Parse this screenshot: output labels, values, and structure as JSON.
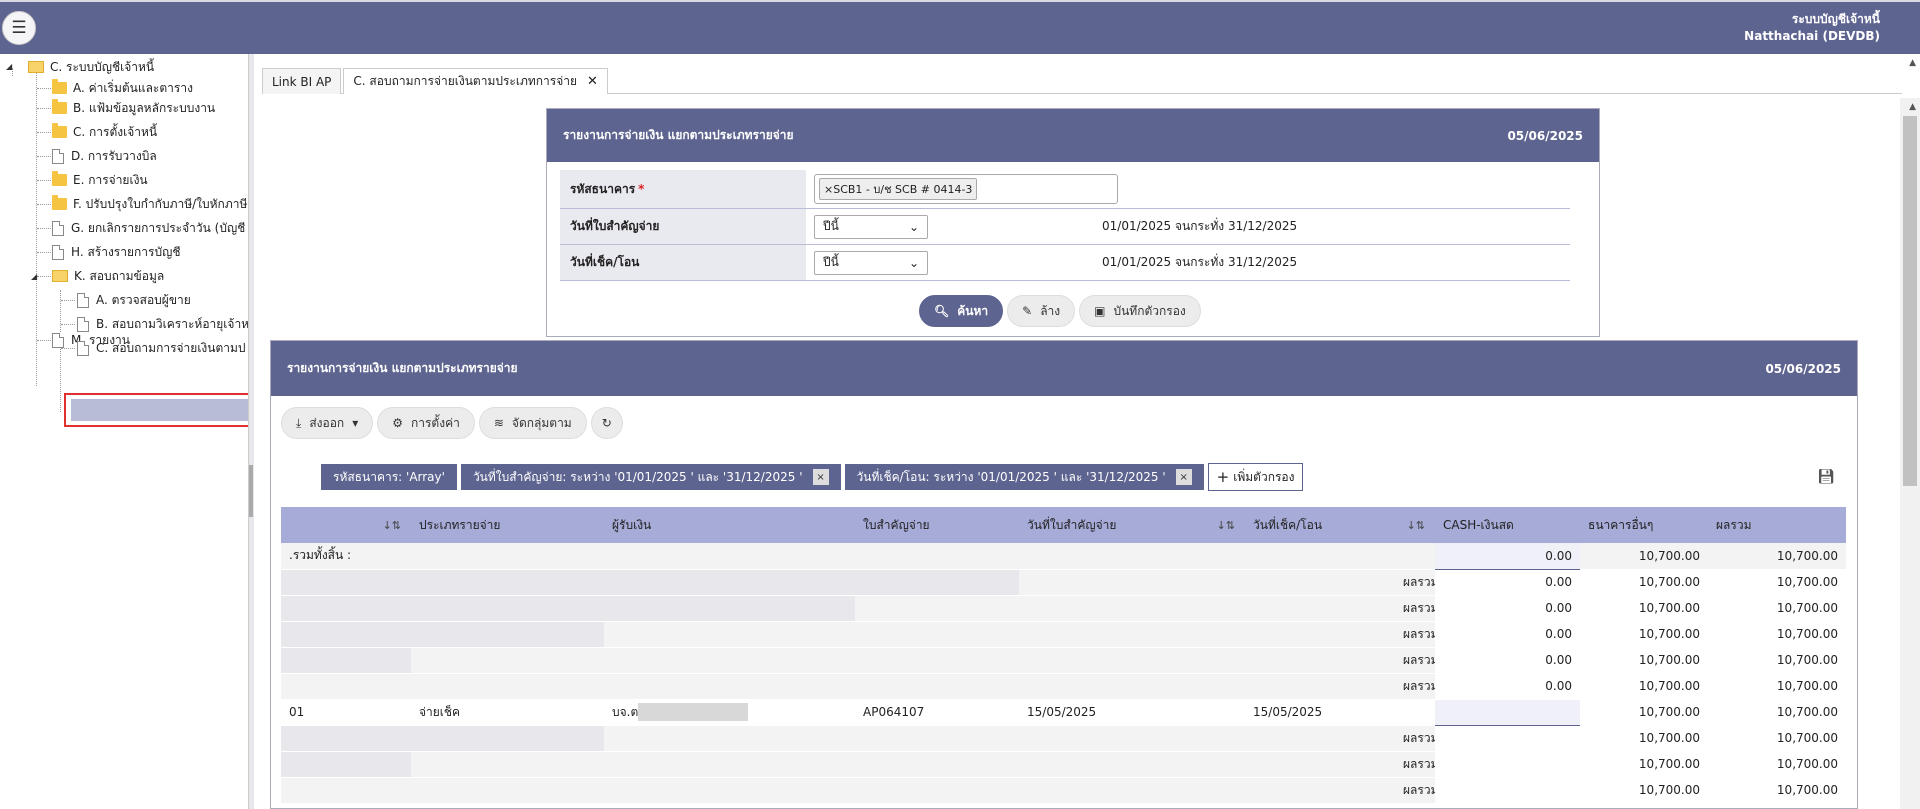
{
  "header": {
    "menu_icon": "hamburger-icon",
    "system_name": "ระบบบัญชีเจ้าหนี้",
    "user": "Natthachai (DEVDB)"
  },
  "sidebar": {
    "root": "C. ระบบบัญชีเจ้าหนี้",
    "items": [
      {
        "label": "A. ค่าเริ่มต้นและตาราง",
        "icon": "folder-icon"
      },
      {
        "label": "B. แฟ้มข้อมูลหลักระบบงาน",
        "icon": "folder-icon"
      },
      {
        "label": "C. การตั้งเจ้าหนี้",
        "icon": "folder-icon"
      },
      {
        "label": "D. การรับวางบิล",
        "icon": "file-icon"
      },
      {
        "label": "E. การจ่ายเงิน",
        "icon": "folder-icon"
      },
      {
        "label": "F. ปรับปรุงใบกำกับภาษี/ใบหักภาษี",
        "icon": "folder-icon"
      },
      {
        "label": "G. ยกเลิกรายการประจำวัน (บัญชี",
        "icon": "file-icon"
      },
      {
        "label": "H. สร้างรายการบัญชี",
        "icon": "file-icon"
      },
      {
        "label": "K. สอบถามข้อมูล",
        "icon": "folder-open-icon"
      },
      {
        "label": "M. รายงาน",
        "icon": "file-icon"
      }
    ],
    "sub_items": [
      {
        "label": "A. ตรวจสอบผู้ขาย"
      },
      {
        "label": "B. สอบถามวิเคราะห์อายุเจ้าห"
      },
      {
        "label": "C. สอบถามการจ่ายเงินตามป"
      }
    ]
  },
  "tabs": [
    {
      "label": "Link BI AP"
    },
    {
      "label": "C. สอบถามการจ่ายเงินตามประเภทการจ่าย",
      "close": "✕"
    }
  ],
  "filter_panel": {
    "title": "รายงานการจ่ายเงิน แยกตามประเภทรายจ่าย",
    "date": "05/06/2025",
    "rows": [
      {
        "label": "รหัสธนาคาร",
        "required": "*",
        "chip": "SCB1 - บ/ช SCB # 0414-3",
        "chip_x": "×"
      },
      {
        "label": "วันที่ใบสำคัญจ่าย",
        "select": "ปีนี้",
        "range": "01/01/2025 จนกระทั่ง 31/12/2025"
      },
      {
        "label": "วันที่เช็ค/โอน",
        "select": "ปีนี้",
        "range": "01/01/2025 จนกระทั่ง 31/12/2025"
      }
    ],
    "buttons": {
      "search": "ค้นหา",
      "clear": "ล้าง",
      "save_filter": "บันทึกตัวกรอง"
    }
  },
  "report_panel": {
    "title": "รายงานการจ่ายเงิน แยกตามประเภทรายจ่าย",
    "date": "05/06/2025",
    "toolbar": {
      "export": "ส่งออก",
      "settings": "การตั้งค่า",
      "group_by": "จัดกลุ่มตาม"
    },
    "filter_chips": [
      {
        "label": "รหัสธนาคาร: 'Array'"
      },
      {
        "label": "วันที่ใบสำคัญจ่าย: ระหว่าง '01/01/2025 ' และ '31/12/2025 '",
        "x": "×"
      },
      {
        "label": "วันที่เช็ค/โอน: ระหว่าง '01/01/2025 ' และ '31/12/2025 '",
        "x": "×"
      }
    ],
    "add_filter": "เพิ่มตัวกรอง",
    "columns": [
      "",
      "ประเภทรายจ่าย",
      "ผู้รับเงิน",
      "ใบสำคัญจ่าย",
      "วันที่ใบสำคัญจ่าย",
      "",
      "วันที่เช็ค/โอน",
      "",
      "CASH-เงินสด",
      "ธนาคารอื่นๆ",
      "ผลรวม"
    ],
    "total_label": ".รวมทั้งสิ้น :",
    "subtotal_label": "ผลรวม",
    "rows": [
      {
        "type": "total",
        "cash": "0.00",
        "other": "10,700.00",
        "sum": "10,700.00"
      },
      {
        "type": "sub",
        "level": 1,
        "cash": "0.00",
        "other": "10,700.00",
        "sum": "10,700.00"
      },
      {
        "type": "sub",
        "level": 2,
        "cash": "0.00",
        "other": "10,700.00",
        "sum": "10,700.00"
      },
      {
        "type": "sub",
        "level": 3,
        "cash": "0.00",
        "other": "10,700.00",
        "sum": "10,700.00"
      },
      {
        "type": "sub",
        "level": 4,
        "cash": "0.00",
        "other": "10,700.00",
        "sum": "10,700.00"
      },
      {
        "type": "sub",
        "level": 5,
        "cash": "0.00",
        "other": "10,700.00",
        "sum": "10,700.00"
      },
      {
        "type": "detail",
        "code": "01",
        "pay_type": "จ่ายเช็ค",
        "payee": "บจ.ต",
        "voucher": "AP064107",
        "voucher_date": "15/05/2025",
        "cheque_date": "15/05/2025",
        "cash": "",
        "other": "10,700.00",
        "sum": "10,700.00"
      },
      {
        "type": "sub",
        "level": 3,
        "cash": "",
        "other": "10,700.00",
        "sum": "10,700.00"
      },
      {
        "type": "sub",
        "level": 4,
        "cash": "",
        "other": "10,700.00",
        "sum": "10,700.00"
      },
      {
        "type": "sub",
        "level": 5,
        "cash": "",
        "other": "10,700.00",
        "sum": "10,700.00"
      }
    ]
  }
}
